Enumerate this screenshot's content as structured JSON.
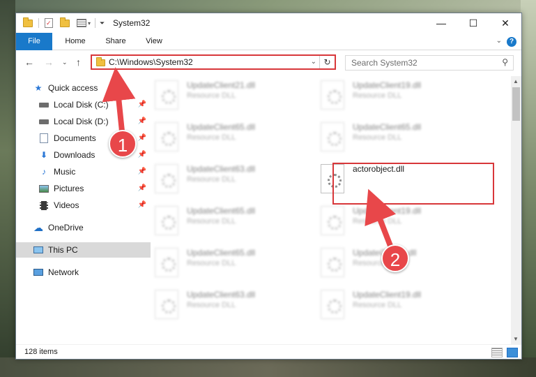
{
  "window": {
    "title": "System32",
    "minimize_glyph": "—",
    "maximize_glyph": "☐",
    "close_glyph": "✕"
  },
  "ribbon": {
    "tabs": [
      "File",
      "Home",
      "Share",
      "View"
    ]
  },
  "address": {
    "path": "C:\\Windows\\System32"
  },
  "search": {
    "placeholder": "Search System32"
  },
  "navpane": {
    "items": [
      {
        "label": "Quick access",
        "icon": "star-icon"
      },
      {
        "label": "Local Disk (C:)",
        "icon": "drive-icon"
      },
      {
        "label": "Local Disk (D:)",
        "icon": "drive-icon"
      },
      {
        "label": "Documents",
        "icon": "documents-icon"
      },
      {
        "label": "Downloads",
        "icon": "download-arrow-icon"
      },
      {
        "label": "Music",
        "icon": "music-note-icon"
      },
      {
        "label": "Pictures",
        "icon": "pictures-icon"
      },
      {
        "label": "Videos",
        "icon": "film-icon"
      },
      {
        "label": "OneDrive",
        "icon": "cloud-icon"
      },
      {
        "label": "This PC",
        "icon": "monitor-icon"
      },
      {
        "label": "Network",
        "icon": "network-icon"
      }
    ]
  },
  "files": {
    "col1": [
      {
        "name": "UpdateClient21.dll",
        "type": "Resource DLL"
      },
      {
        "name": "UpdateClient65.dll",
        "type": "Resource DLL"
      },
      {
        "name": "UpdateClient63.dll",
        "type": "Resource DLL"
      },
      {
        "name": "UpdateClient65.dll",
        "type": "Resource DLL"
      },
      {
        "name": "UpdateClient65.dll",
        "type": "Resource DLL"
      },
      {
        "name": "UpdateClient63.dll",
        "type": "Resource DLL"
      }
    ],
    "col2": [
      {
        "name": "UpdateClient19.dll",
        "type": "Resource DLL"
      },
      {
        "name": "UpdateClient65.dll",
        "type": "Resource DLL"
      },
      {
        "name": "actorobject.dll",
        "type": ""
      },
      {
        "name": "UpdateClient19.dll",
        "type": "Resource DLL"
      },
      {
        "name": "UpdateClient5.dll",
        "type": "Resource DLL"
      },
      {
        "name": "UpdateClient19.dll",
        "type": "Resource DLL"
      }
    ]
  },
  "status": {
    "count": "128 items"
  },
  "annotations": {
    "badge1": "1",
    "badge2": "2",
    "color": "#e8474a"
  }
}
